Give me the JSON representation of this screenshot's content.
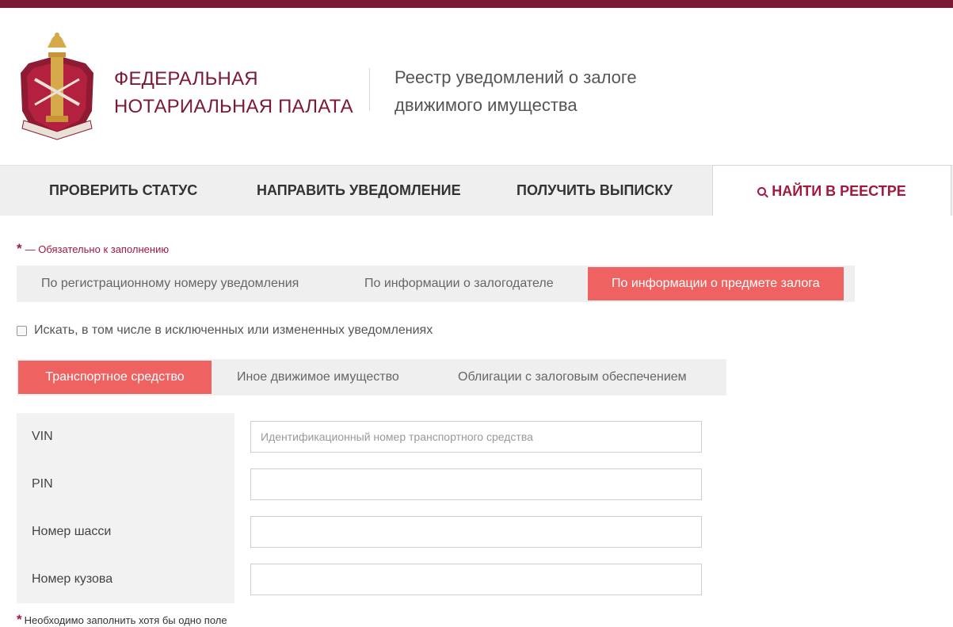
{
  "colors": {
    "brand": "#7a1a35",
    "accent": "#a0193f",
    "active_tab": "#ef6262",
    "tab_bg": "#efefef"
  },
  "header": {
    "logo_icon": "notary-emblem-icon",
    "org_line1": "ФЕДЕРАЛЬНАЯ",
    "org_line2": "НОТАРИАЛЬНАЯ ПАЛАТА",
    "registry_line1": "Реестр уведомлений о залоге",
    "registry_line2": "движимого имущества"
  },
  "main_nav": {
    "items": [
      {
        "label": "ПРОВЕРИТЬ СТАТУС"
      },
      {
        "label": "НАПРАВИТЬ УВЕДОМЛЕНИЕ"
      },
      {
        "label": "ПОЛУЧИТЬ ВЫПИСКУ"
      },
      {
        "label": "НАЙТИ В РЕЕСТРЕ",
        "icon": "search-icon",
        "active": true
      }
    ]
  },
  "required_note": {
    "star": "*",
    "text": "— Обязательно к заполнению"
  },
  "search_tabs": [
    {
      "label": "По регистрационному номеру уведомления"
    },
    {
      "label": "По информации о залогодателе"
    },
    {
      "label": "По информации о предмете залога",
      "active": true
    }
  ],
  "include_excluded": {
    "label": "Искать, в том числе в исключенных или измененных уведомлениях",
    "checked": false
  },
  "subject_tabs": [
    {
      "label": "Транспортное средство",
      "active": true
    },
    {
      "label": "Иное движимое имущество"
    },
    {
      "label": "Облигации с залоговым обеспечением"
    }
  ],
  "form": {
    "fields": [
      {
        "label": "VIN",
        "value": "",
        "placeholder": "Идентификационный номер транспортного средства"
      },
      {
        "label": "PIN",
        "value": "",
        "placeholder": ""
      },
      {
        "label": "Номер шасси",
        "value": "",
        "placeholder": ""
      },
      {
        "label": "Номер кузова",
        "value": "",
        "placeholder": ""
      }
    ]
  },
  "footnote": {
    "star": "*",
    "text": "Необходимо заполнить хотя бы одно поле"
  }
}
